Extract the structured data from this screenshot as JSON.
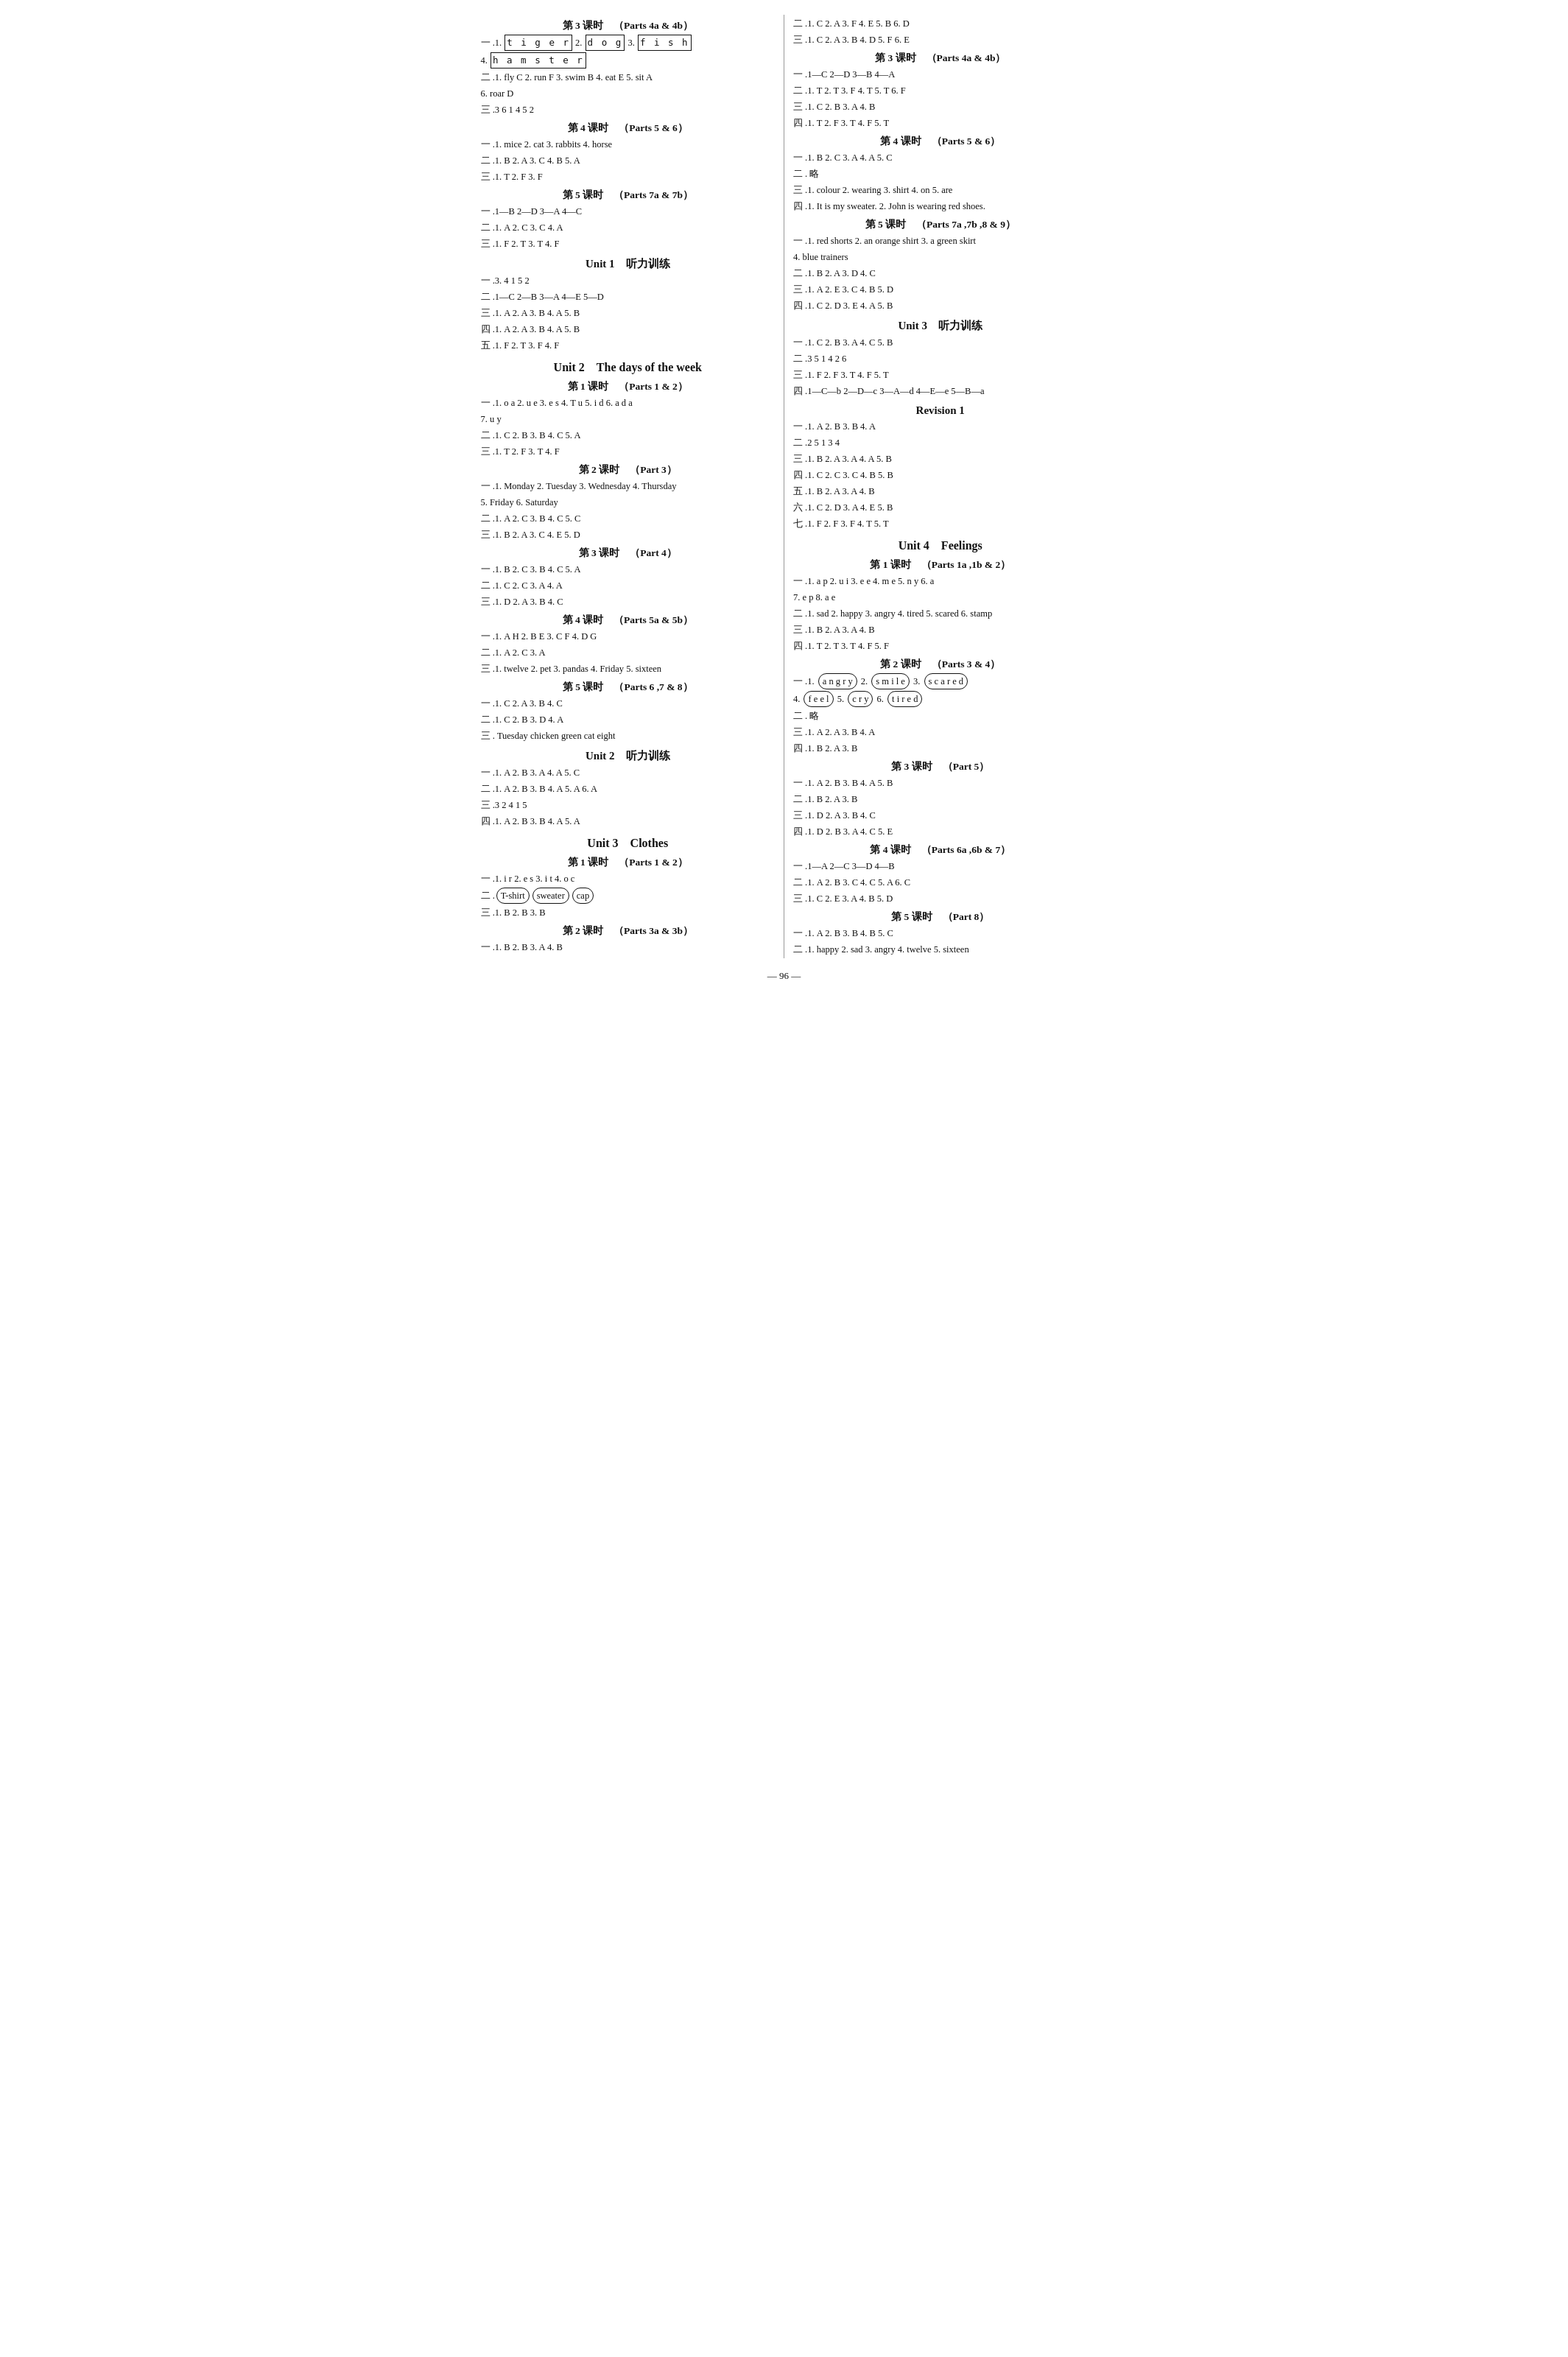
{
  "page": {
    "number": "96",
    "left_column": [
      {
        "type": "section",
        "text": "第 3 课时　（Parts 4a & 4b）"
      },
      {
        "type": "lines",
        "lines": [
          "一 .1. t i g e r  2. d o g  3. f i s h",
          "4. h a m s t e r",
          "二 .1. fly  C  2. run  F  3. swim  B  4. eat  E  5. sit  A",
          "6. roar  D",
          "三 .3  6  1  4  5  2"
        ]
      },
      {
        "type": "section",
        "text": "第 4 课时　（Parts 5 & 6）"
      },
      {
        "type": "lines",
        "lines": [
          "一 .1. mice  2. cat  3. rabbits  4. horse",
          "二 .1. B  2. A  3. C  4. B  5. A",
          "三 .1. T  2. F  3. F"
        ]
      },
      {
        "type": "section",
        "text": "第 5 课时　（Parts 7a & 7b）"
      },
      {
        "type": "lines",
        "lines": [
          "一 .1—B  2—D  3—A  4—C",
          "二 .1. A  2. C  3. C  4. A",
          "三 .1. F  2. T  3. T  4. F"
        ]
      },
      {
        "type": "unit",
        "text": "Unit 1　听力训练"
      },
      {
        "type": "lines",
        "lines": [
          "一 .3. 4  1  5  2",
          "二 .1—C  2—B  3—A  4—E  5—D",
          "三 .1. A  2. A  3. B  4. A  5. B",
          "四 .1. A  2. A  3. B  4. A  5. B",
          "五 .1. F  2. T  3. F  4. F"
        ]
      },
      {
        "type": "unit-big",
        "text": "Unit 2　The days of the week"
      },
      {
        "type": "section",
        "text": "第 1 课时　（Parts 1 & 2）"
      },
      {
        "type": "lines",
        "lines": [
          "一 .1. o  a  2. u  e  3. e  s  4. T  u  5. i  d  6. a  d  a",
          "7. u  y",
          "二 .1. C  2. B  3. B  4. C  5. A",
          "三 .1. T  2. F  3. T  4. F"
        ]
      },
      {
        "type": "section",
        "text": "第 2 课时　（Part 3）"
      },
      {
        "type": "lines",
        "lines": [
          "一 .1. Monday  2. Tuesday  3. Wednesday  4. Thursday",
          "5. Friday  6. Saturday",
          "二 .1. A  2. C  3. B  4. C  5. C",
          "三 .1. B  2. A  3. C  4. E  5. D"
        ]
      },
      {
        "type": "section",
        "text": "第 3 课时　（Part 4）"
      },
      {
        "type": "lines",
        "lines": [
          "一 .1. B  2. C  3. B  4. C  5. A",
          "二 .1. C  2. C  3. A  4. A",
          "三 .1. D  2. A  3. B  4. C"
        ]
      },
      {
        "type": "section",
        "text": "第 4 课时　（Parts 5a & 5b）"
      },
      {
        "type": "lines",
        "lines": [
          "一 .1. A  H  2. B  E  3. C  F  4. D  G",
          "二 .1. A  2. C  3. A",
          "三 .1. twelve  2. pet  3. pandas  4. Friday  5. sixteen"
        ]
      },
      {
        "type": "section",
        "text": "第 5 课时　（Parts 6 ,7 & 8）"
      },
      {
        "type": "lines",
        "lines": [
          "一 .1. C  2. A  3. B  4. C",
          "二 .1. C  2. B  3. D  4. A",
          "三 . Tuesday  chicken  green  cat  eight"
        ]
      },
      {
        "type": "unit",
        "text": "Unit 2　听力训练"
      },
      {
        "type": "lines",
        "lines": [
          "一 .1. A  2. B  3. A  4. A  5. C",
          "二 .1. A  2. B  3. B  4. A  5. A  6. A",
          "三 .3  2  4  1  5",
          "四 .1. A  2. B  3. B  4. A  5. A"
        ]
      },
      {
        "type": "unit-big",
        "text": "Unit 3　Clothes"
      },
      {
        "type": "section",
        "text": "第 1 课时　（Parts 1 & 2）"
      },
      {
        "type": "lines",
        "lines": [
          "一 .1. i  r  2. e  s  3. i  t  4. o  c",
          "二 .（T-shirt）（sweater）（cap）",
          "三 .1. B  2. B  3. B"
        ]
      },
      {
        "type": "section",
        "text": "第 2 课时　（Parts 3a & 3b）"
      },
      {
        "type": "lines",
        "lines": [
          "一 .1. B  2. B  3. A  4. B"
        ]
      }
    ],
    "right_column": [
      {
        "type": "lines",
        "lines": [
          "二 .1. C  2. A  3. F  4. E  5. B  6. D",
          "三 .1. C  2. A  3. B  4. D  5. F  6. E"
        ]
      },
      {
        "type": "section",
        "text": "第 3 课时　（Parts 4a & 4b）"
      },
      {
        "type": "lines",
        "lines": [
          "一 .1—C  2—D  3—B  4—A",
          "二 .1. T  2. T  3. F  4. T  5. T  6. F",
          "三 .1. C  2. B  3. A  4. B",
          "四 .1. T  2. F  3. T  4. F  5. T"
        ]
      },
      {
        "type": "section",
        "text": "第 4 课时　（Parts 5 & 6）"
      },
      {
        "type": "lines",
        "lines": [
          "一 .1. B  2. C  3. A  4. A  5. C",
          "二 . 略",
          "三 .1. colour  2. wearing  3. shirt  4. on  5. are",
          "四 .1. It is my sweater.  2. John is wearing red shoes."
        ]
      },
      {
        "type": "section",
        "text": "第 5 课时　（Parts 7a ,7b ,8 & 9）"
      },
      {
        "type": "lines",
        "lines": [
          "一 .1. red shorts  2. an orange shirt  3. a green skirt",
          "4. blue trainers",
          "二 .1. B  2. A  3. D  4. C",
          "三 .1. A  2. E  3. C  4. B  5. D",
          "四 .1. C  2. D  3. E  4. A  5. B"
        ]
      },
      {
        "type": "unit",
        "text": "Unit 3　听力训练"
      },
      {
        "type": "lines",
        "lines": [
          "一 .1. C  2. B  3. A  4. C  5. B",
          "二 .3  5  1  4  2  6",
          "三 .1. F  2. F  3. T  4. F  5. T",
          "四 .1—C—b  2—D—c  3—A—d  4—E—e  5—B—a"
        ]
      },
      {
        "type": "unit",
        "text": "Revision 1"
      },
      {
        "type": "lines",
        "lines": [
          "一 .1. A  2. B  3. B  4. A",
          "二 .2  5  1  3  4",
          "三 .1. B  2. A  3. A  4. A  5. B",
          "四 .1. C  2. C  3. C  4. B  5. B",
          "五 .1. B  2. A  3. A  4. B",
          "六 .1. C  2. D  3. A  4. E  5. B",
          "七 .1. F  2. F  3. F  4. T  5. T"
        ]
      },
      {
        "type": "unit-big",
        "text": "Unit 4　Feelings"
      },
      {
        "type": "section",
        "text": "第 1 课时　（Parts 1a ,1b & 2）"
      },
      {
        "type": "lines",
        "lines": [
          "一 .1. a  p  2. u  i  3. e  e  4. m  e  5. n  y  6. a",
          "7. e  p  8. a  e",
          "二 .1. sad  2. happy  3. angry  4. tired  5. scared  6. stamp",
          "三 .1. B  2. A  3. A  4. B",
          "四 .1. T  2. T  3. T  4. F  5. F"
        ]
      },
      {
        "type": "section",
        "text": "第 2 课时　（Parts 3 & 4）"
      },
      {
        "type": "lines-special",
        "items": [
          {
            "prefix": "一 .1.",
            "word": "angry",
            "circle": true
          },
          {
            "prefix": " 2.",
            "word": "smile",
            "circle": true
          },
          {
            "prefix": " 3.",
            "word": "scared",
            "circle": true
          },
          {
            "prefix": " 4.",
            "word": "feel",
            "circle": true
          },
          {
            "prefix": " 5.",
            "word": "cry",
            "circle": true
          },
          {
            "prefix": " 6.",
            "word": "tired",
            "circle": true
          }
        ]
      },
      {
        "type": "lines",
        "lines": [
          "二 . 略",
          "三 .1. A  2. A  3. B  4. A",
          "四 .1. B  2. A  3. B"
        ]
      },
      {
        "type": "section",
        "text": "第 3 课时　（Part 5）"
      },
      {
        "type": "lines",
        "lines": [
          "一 .1. A  2. B  3. B  4. A  5. B",
          "二 .1. B  2. A  3. B",
          "三 .1. D  2. A  3. B  4. C",
          "四 .1. D  2. B  3. A  4. C  5. E"
        ]
      },
      {
        "type": "section",
        "text": "第 4 课时　（Parts 6a ,6b & 7）"
      },
      {
        "type": "lines",
        "lines": [
          "一 .1—A  2—C  3—D  4—B",
          "二 .1. A  2. B  3. C  4. C  5. A  6. C",
          "三 .1. C  2. E  3. A  4. B  5. D"
        ]
      },
      {
        "type": "section",
        "text": "第 5 课时　（Part 8）"
      },
      {
        "type": "lines",
        "lines": [
          "一 .1. A  2. B  3. B  4. B  5. C",
          "二 .1. happy  2. sad  3. angry  4. twelve  5. sixteen"
        ]
      }
    ]
  }
}
